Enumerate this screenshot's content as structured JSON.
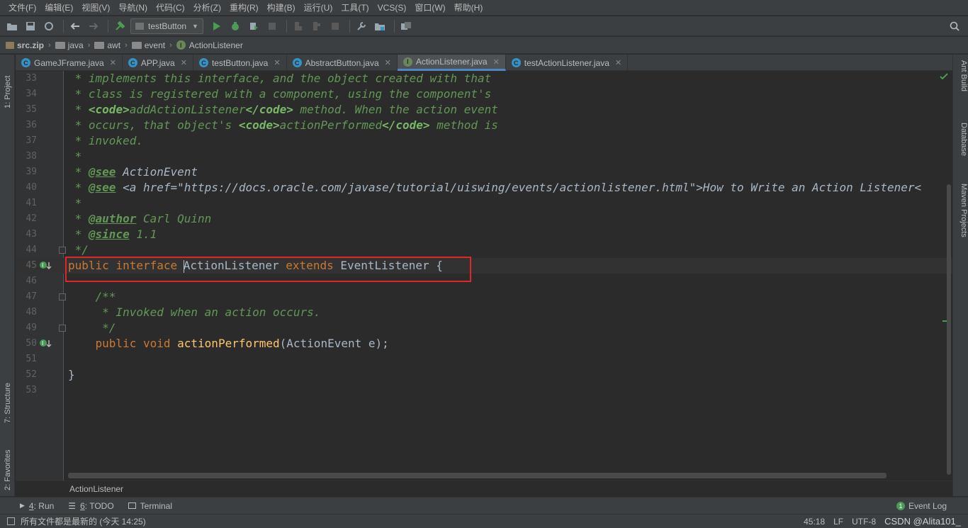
{
  "menu": [
    "文件(F)",
    "编辑(E)",
    "视图(V)",
    "导航(N)",
    "代码(C)",
    "分析(Z)",
    "重构(R)",
    "构建(B)",
    "运行(U)",
    "工具(T)",
    "VCS(S)",
    "窗口(W)",
    "帮助(H)"
  ],
  "toolbar": {
    "run_config": "testButton"
  },
  "breadcrumbs": [
    "src.zip",
    "java",
    "awt",
    "event",
    "ActionListener"
  ],
  "tabs": [
    {
      "label": "GameJFrame.java",
      "icon": "class"
    },
    {
      "label": "APP.java",
      "icon": "class"
    },
    {
      "label": "testButton.java",
      "icon": "class"
    },
    {
      "label": "AbstractButton.java",
      "icon": "class"
    },
    {
      "label": "ActionListener.java",
      "icon": "interface",
      "active": true
    },
    {
      "label": "testActionListener.java",
      "icon": "class"
    }
  ],
  "side_tabs": {
    "left": [
      "1: Project",
      "7: Structure",
      "2: Favorites"
    ],
    "right": [
      "Ant Build",
      "Database",
      "Maven Projects"
    ]
  },
  "code": {
    "l33": {
      "num": "33",
      "text": " * implements this interface, and the object created with that"
    },
    "l34": {
      "num": "34",
      "text": " * class is registered with a component, using the component's"
    },
    "l35": {
      "num": "35",
      "pre": " * ",
      "tag1": "<code>",
      "mid": "addActionListener",
      "tag2": "</code>",
      "post": " method. When the action event"
    },
    "l36": {
      "num": "36",
      "pre": " * occurs, that object's ",
      "tag1": "<code>",
      "mid": "actionPerformed",
      "tag2": "</code>",
      "post": " method is"
    },
    "l37": {
      "num": "37",
      "text": " * invoked."
    },
    "l38": {
      "num": "38",
      "text": " *"
    },
    "l39": {
      "num": "39",
      "pre": " * ",
      "tag": "@see",
      "post": " ActionEvent"
    },
    "l40": {
      "num": "40",
      "pre": " * ",
      "tag": "@see",
      "post": " <a href=\"https://docs.oracle.com/javase/tutorial/uiswing/events/actionlistener.html\">How to Write an Action Listener<"
    },
    "l41": {
      "num": "41",
      "text": " *"
    },
    "l42": {
      "num": "42",
      "pre": " * ",
      "tag": "@author",
      "post": " Carl Quinn"
    },
    "l43": {
      "num": "43",
      "pre": " * ",
      "tag": "@since",
      "post": " 1.1"
    },
    "l44": {
      "num": "44",
      "text": " */"
    },
    "l45": {
      "num": "45",
      "kw1": "public",
      "kw2": "interface",
      "name": "ActionListener",
      "kw3": "extends",
      "sup": "EventListener {"
    },
    "l46": {
      "num": "46"
    },
    "l47": {
      "num": "47",
      "text": "    /**"
    },
    "l48": {
      "num": "48",
      "text": "     * Invoked when an action occurs."
    },
    "l49": {
      "num": "49",
      "text": "     */"
    },
    "l50": {
      "num": "50",
      "kw1": "public",
      "kw2": "void",
      "fn": "actionPerformed",
      "args": "(ActionEvent e);"
    },
    "l51": {
      "num": "51"
    },
    "l52": {
      "num": "52",
      "text": "}"
    },
    "l53": {
      "num": "53"
    }
  },
  "editor_breadcrumb": "ActionListener",
  "bottom_tools": {
    "run_num": "4",
    "run_label": ": Run",
    "todo_num": "6",
    "todo_label": ": TODO",
    "terminal": "Terminal",
    "event_log": "Event Log"
  },
  "status": {
    "message": "所有文件都是最新的 (今天 14:25)",
    "position": "45:18",
    "line_sep": "LF",
    "encoding": "UTF-8",
    "watermark": "CSDN @Alita101_"
  },
  "colors": {
    "keyword": "#cc7832",
    "doc": "#629755",
    "function": "#ffc66d",
    "highlight_box": "#e0262c"
  }
}
